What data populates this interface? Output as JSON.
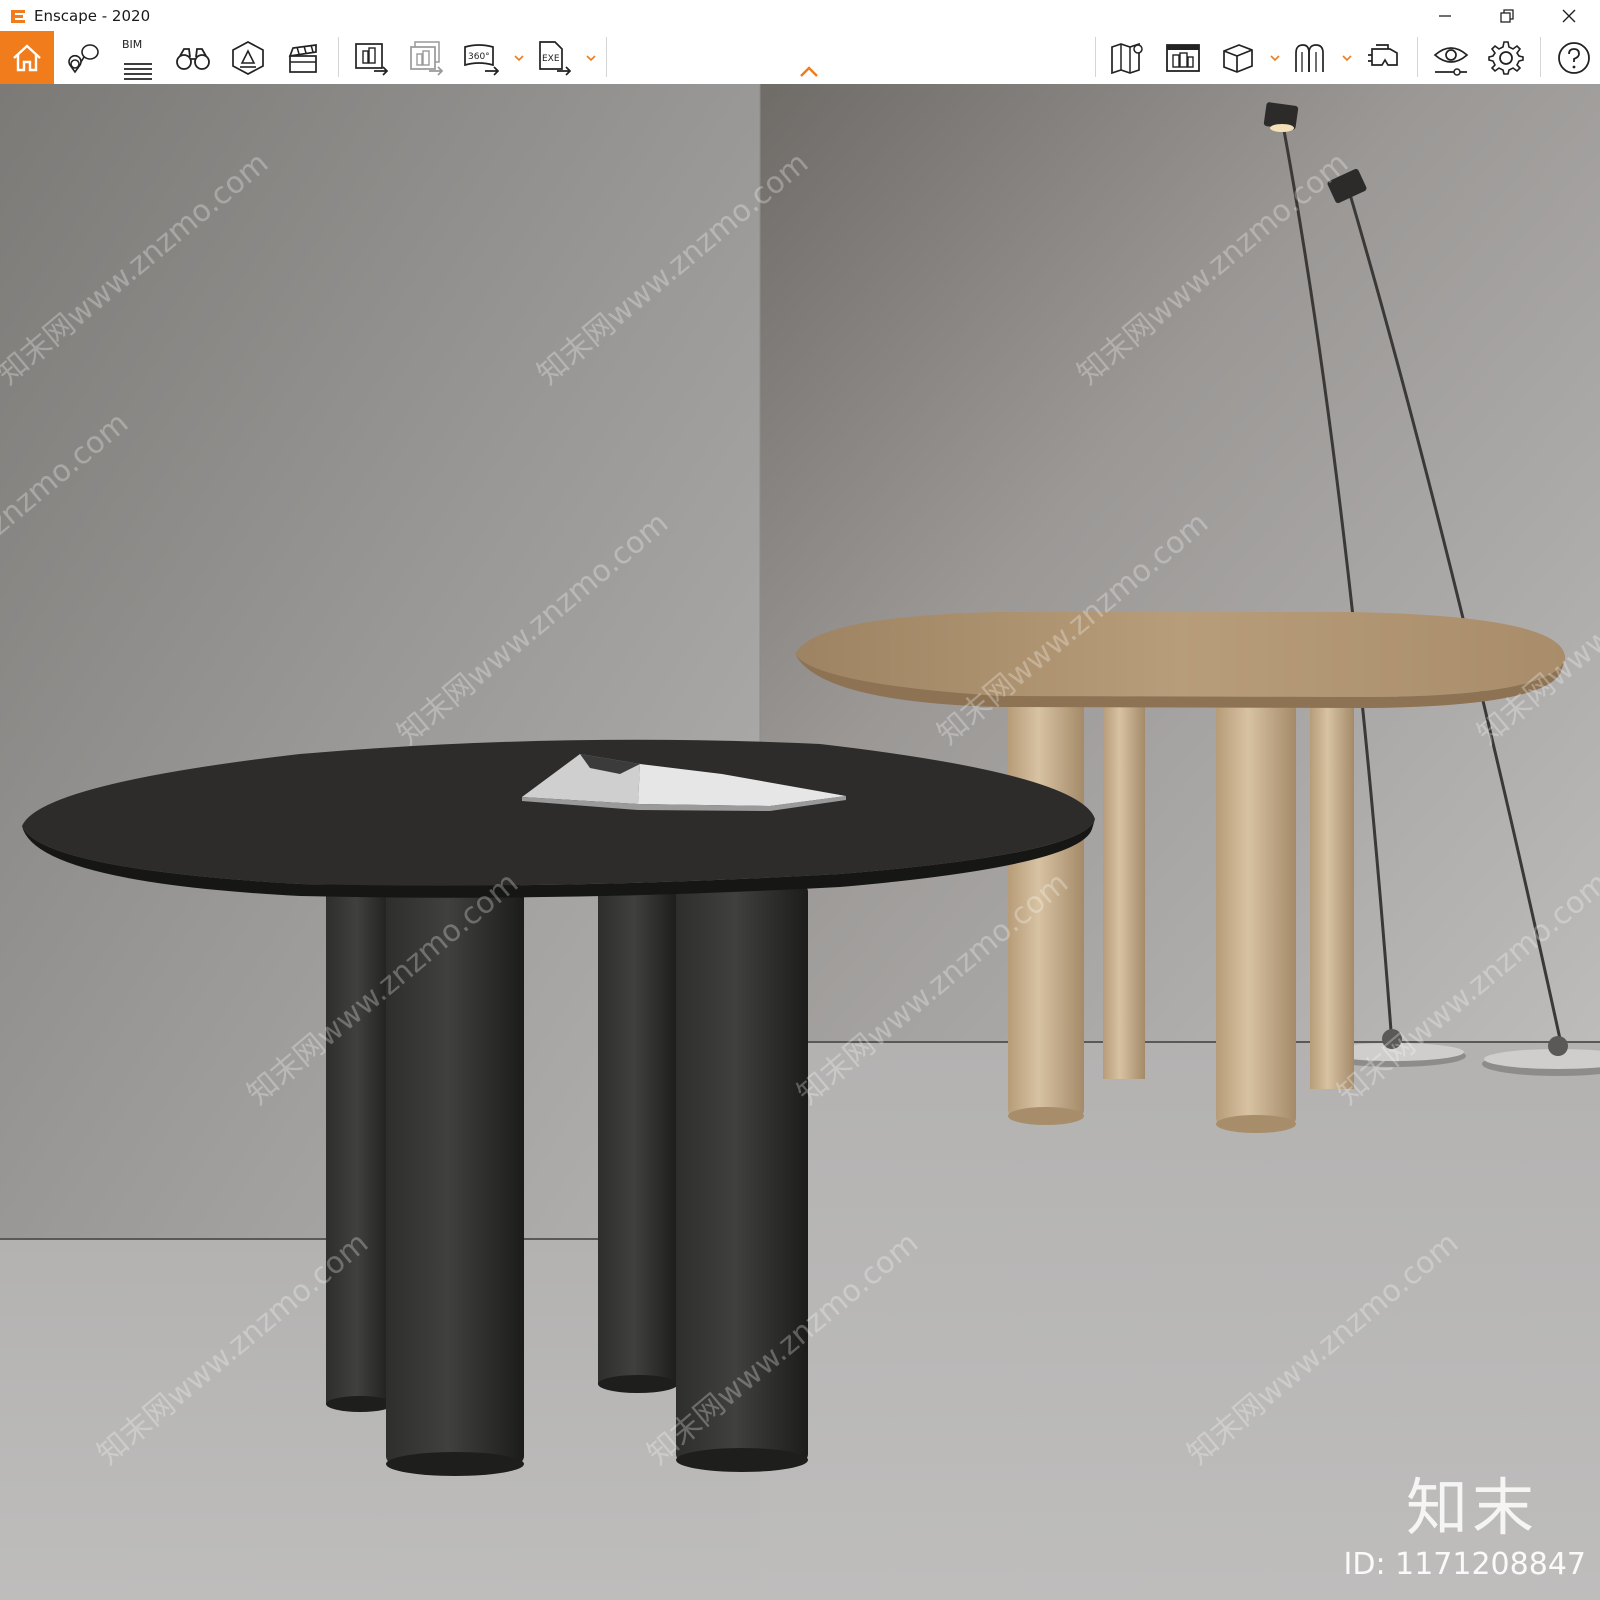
{
  "window": {
    "title": "Enscape - 2020",
    "accent": "#f07c1b"
  },
  "toolbar": {
    "bim_label": "BIM",
    "video_360_label": "360°",
    "exe_label": "EXE",
    "left_tools": [
      "home-icon",
      "pin-icon",
      "bim-icon",
      "binoculars-icon",
      "sun-icon",
      "clapper-icon"
    ],
    "export_tools": [
      "render-export-icon",
      "batch-render-icon",
      "panorama-360-icon",
      "exe-export-icon"
    ],
    "right_tools": [
      "map-icon",
      "asset-library-icon",
      "cube-icon",
      "material-icon",
      "vr-headset-icon",
      "visual-settings-icon",
      "gear-icon",
      "help-icon"
    ]
  },
  "viewport": {
    "watermark": "知末网www.znzmo.com",
    "brand": "知末",
    "image_id": "ID: 1171208847"
  }
}
